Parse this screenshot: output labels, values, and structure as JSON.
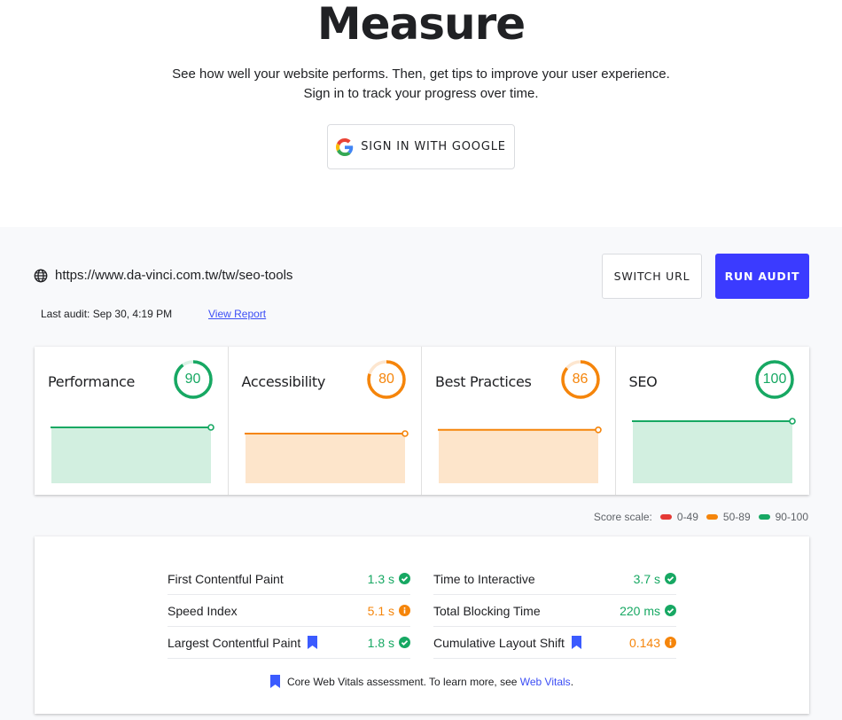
{
  "hero": {
    "title": "Measure",
    "subtitle_line1": "See how well your website performs. Then, get tips to improve your user experience.",
    "subtitle_line2": "Sign in to track your progress over time.",
    "signin_label": "SIGN IN WITH GOOGLE"
  },
  "audit": {
    "url": "https://www.da-vinci.com.tw/tw/seo-tools",
    "last_audit": "Last audit: Sep 30, 4:19 PM",
    "view_report_label": "View Report",
    "switch_url_label": "SWITCH URL",
    "run_audit_label": "RUN AUDIT"
  },
  "colors": {
    "good": "#17a863",
    "average": "#f5850b",
    "poor": "#e53935",
    "accent": "#3b3bff"
  },
  "categories": [
    {
      "name": "Performance",
      "score": 90,
      "status": "good"
    },
    {
      "name": "Accessibility",
      "score": 80,
      "status": "average"
    },
    {
      "name": "Best Practices",
      "score": 86,
      "status": "average"
    },
    {
      "name": "SEO",
      "score": 100,
      "status": "good"
    }
  ],
  "legend": {
    "label": "Score scale:",
    "items": [
      {
        "range": "0-49",
        "status": "poor"
      },
      {
        "range": "50-89",
        "status": "average"
      },
      {
        "range": "90-100",
        "status": "good"
      }
    ]
  },
  "metrics": {
    "left": [
      {
        "name": "First Contentful Paint",
        "value": "1.3 s",
        "status": "good",
        "core": false
      },
      {
        "name": "Speed Index",
        "value": "5.1 s",
        "status": "average",
        "core": false
      },
      {
        "name": "Largest Contentful Paint",
        "value": "1.8 s",
        "status": "good",
        "core": true
      }
    ],
    "right": [
      {
        "name": "Time to Interactive",
        "value": "3.7 s",
        "status": "good",
        "core": false
      },
      {
        "name": "Total Blocking Time",
        "value": "220 ms",
        "status": "good",
        "core": false
      },
      {
        "name": "Cumulative Layout Shift",
        "value": "0.143",
        "status": "average",
        "core": true
      }
    ]
  },
  "footnote": {
    "text": "Core Web Vitals assessment. To learn more, see",
    "link": "Web Vitals",
    "end": "."
  }
}
